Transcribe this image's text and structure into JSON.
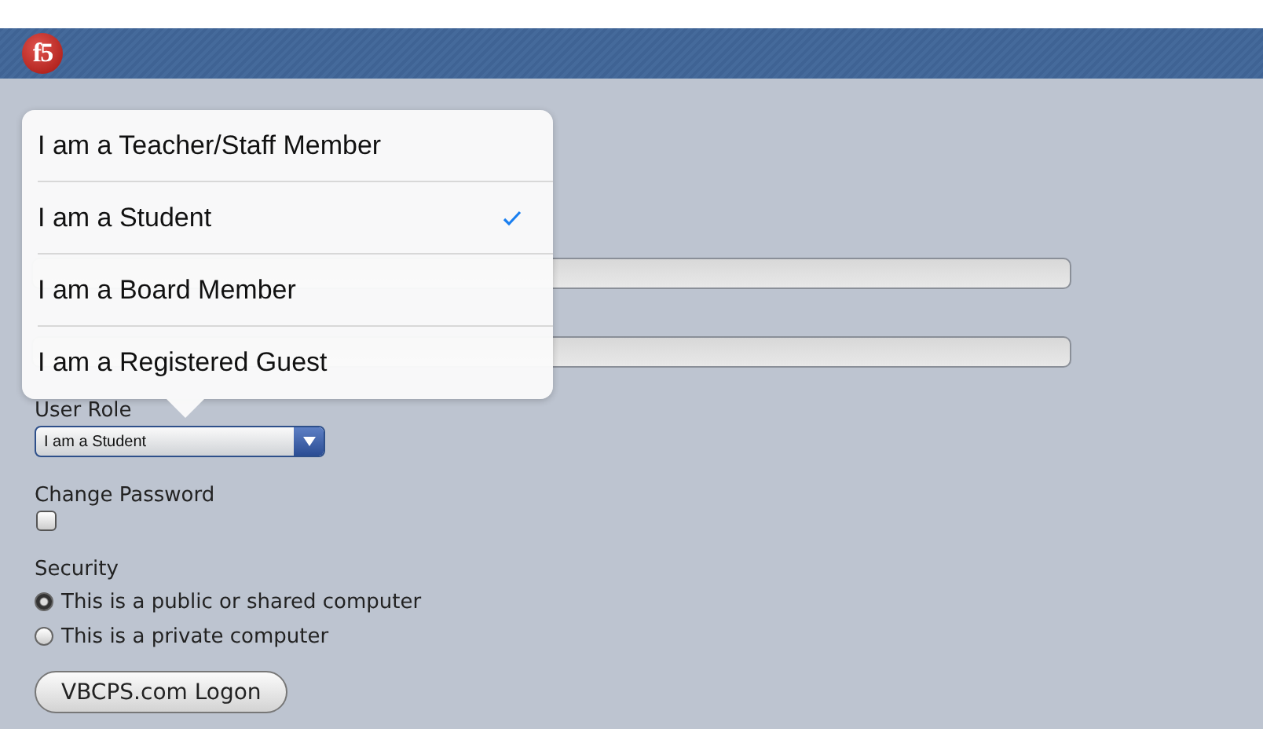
{
  "header": {
    "logo": "f5"
  },
  "form": {
    "user_role": {
      "label": "User Role",
      "value": "I am a Student"
    },
    "change_password": {
      "label": "Change Password",
      "checked": false
    },
    "security": {
      "label": "Security",
      "options": [
        {
          "label": "This is a public or shared computer",
          "selected": true
        },
        {
          "label": "This is a private computer",
          "selected": false
        }
      ]
    },
    "submit": "VBCPS.com Logon"
  },
  "popover": {
    "options": [
      {
        "label": "I am a Teacher/Staff Member",
        "selected": false
      },
      {
        "label": "I am a Student",
        "selected": true
      },
      {
        "label": "I am a Board Member",
        "selected": false
      },
      {
        "label": "I am a Registered Guest",
        "selected": false
      }
    ]
  }
}
